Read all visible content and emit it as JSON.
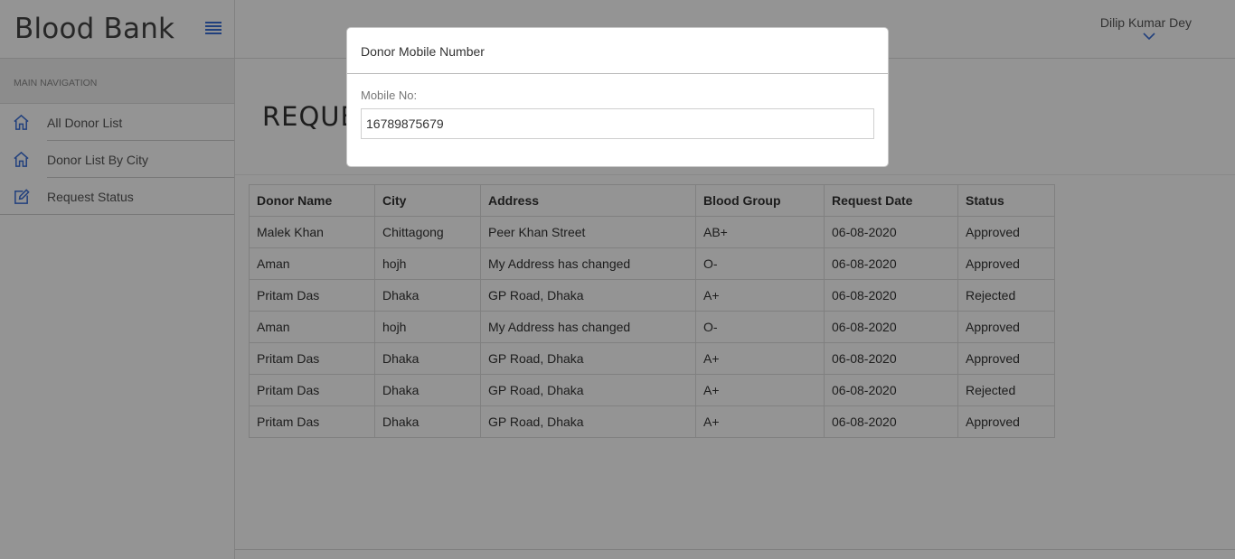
{
  "app": {
    "title": "Blood Bank"
  },
  "sidebar": {
    "section_header": "MAIN NAVIGATION",
    "items": [
      {
        "label": "All Donor List",
        "icon": "home-icon"
      },
      {
        "label": "Donor List By City",
        "icon": "home-icon"
      },
      {
        "label": "Request Status",
        "icon": "edit-icon"
      }
    ]
  },
  "header": {
    "user_name": "Dilip Kumar Dey"
  },
  "page": {
    "title": "REQUE"
  },
  "table": {
    "columns": [
      "Donor Name",
      "City",
      "Address",
      "Blood Group",
      "Request Date",
      "Status"
    ],
    "rows": [
      [
        "Malek Khan",
        "Chittagong",
        "Peer Khan Street",
        "AB+",
        "06-08-2020",
        "Approved"
      ],
      [
        "Aman",
        "hojh",
        "My Address has changed",
        "O-",
        "06-08-2020",
        "Approved"
      ],
      [
        "Pritam Das",
        "Dhaka",
        "GP Road, Dhaka",
        "A+",
        "06-08-2020",
        "Rejected"
      ],
      [
        "Aman",
        "hojh",
        "My Address has changed",
        "O-",
        "06-08-2020",
        "Approved"
      ],
      [
        "Pritam Das",
        "Dhaka",
        "GP Road, Dhaka",
        "A+",
        "06-08-2020",
        "Approved"
      ],
      [
        "Pritam Das",
        "Dhaka",
        "GP Road, Dhaka",
        "A+",
        "06-08-2020",
        "Rejected"
      ],
      [
        "Pritam Das",
        "Dhaka",
        "GP Road, Dhaka",
        "A+",
        "06-08-2020",
        "Approved"
      ]
    ]
  },
  "modal": {
    "title": "Donor Mobile Number",
    "field_label": "Mobile No:",
    "field_value": "16789875679"
  },
  "colors": {
    "accent": "#2a5bd7",
    "overlay": "rgba(0,0,0,0.42)"
  }
}
